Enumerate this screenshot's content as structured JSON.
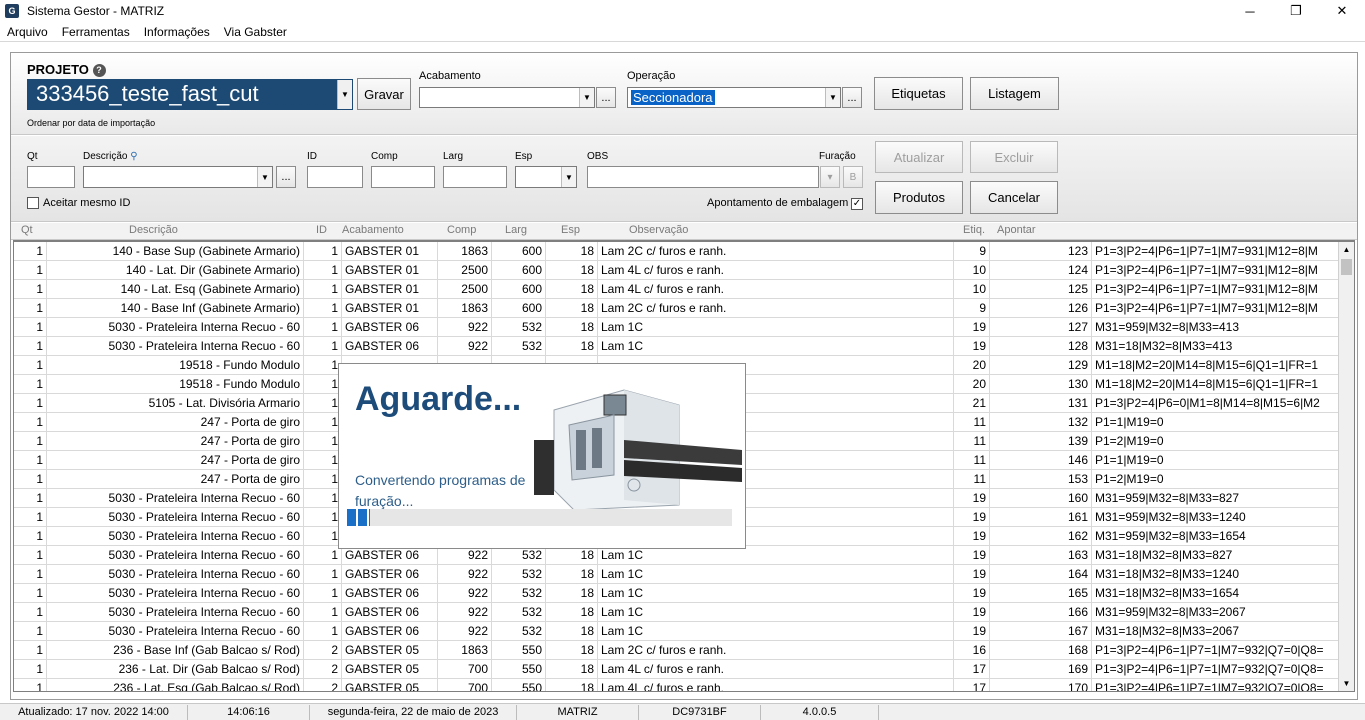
{
  "window": {
    "title": "Sistema Gestor - MATRIZ",
    "app_icon": "G"
  },
  "window_controls": {
    "minimize": "─",
    "maximize": "❐",
    "close": "✕"
  },
  "menu": [
    "Arquivo",
    "Ferramentas",
    "Informações",
    "Via Gabster"
  ],
  "project": {
    "label": "PROJETO",
    "value": "333456_teste_fast_cut",
    "sort_hint": "Ordenar por data de importação",
    "save_label": "Gravar"
  },
  "acabamento": {
    "label": "Acabamento",
    "value": "",
    "more": "..."
  },
  "operacao": {
    "label": "Operação",
    "value": "Seccionadora",
    "more": "..."
  },
  "top_buttons": {
    "etiquetas": "Etiquetas",
    "listagem": "Listagem"
  },
  "form": {
    "qt": "Qt",
    "descricao": "Descrição",
    "id": "ID",
    "comp": "Comp",
    "larg": "Larg",
    "esp": "Esp",
    "obs": "OBS",
    "furacao": "Furação",
    "more": "...",
    "aceitar_mesmo_id": "Aceitar mesmo ID",
    "apontamento": "Apontamento de embalagem",
    "apontamento_checked": "✓"
  },
  "action_buttons": {
    "atualizar": "Atualizar",
    "excluir": "Excluir",
    "produtos": "Produtos",
    "cancelar": "Cancelar"
  },
  "columns": [
    "Qt",
    "Descrição",
    "ID",
    "Acabamento",
    "Comp",
    "Larg",
    "Esp",
    "Observação",
    "Etiq.",
    "Apontar"
  ],
  "rows": [
    {
      "qt": "1",
      "desc": "140 - Base Sup (Gabinete Armario)",
      "id": "1",
      "acab": "GABSTER 01",
      "comp": "1863",
      "larg": "600",
      "esp": "18",
      "obs": "Lam 2C c/ furos e ranh.",
      "etiq": "9",
      "n": "123",
      "prog": "P1=3|P2=4|P6=1|P7=1|M7=931|M12=8|M"
    },
    {
      "qt": "1",
      "desc": "140 - Lat. Dir (Gabinete Armario)",
      "id": "1",
      "acab": "GABSTER 01",
      "comp": "2500",
      "larg": "600",
      "esp": "18",
      "obs": "Lam 4L c/ furos e ranh.",
      "etiq": "10",
      "n": "124",
      "prog": "P1=3|P2=4|P6=1|P7=1|M7=931|M12=8|M"
    },
    {
      "qt": "1",
      "desc": "140 - Lat. Esq (Gabinete Armario)",
      "id": "1",
      "acab": "GABSTER 01",
      "comp": "2500",
      "larg": "600",
      "esp": "18",
      "obs": "Lam 4L c/ furos e ranh.",
      "etiq": "10",
      "n": "125",
      "prog": "P1=3|P2=4|P6=1|P7=1|M7=931|M12=8|M"
    },
    {
      "qt": "1",
      "desc": "140 - Base Inf (Gabinete Armario)",
      "id": "1",
      "acab": "GABSTER 01",
      "comp": "1863",
      "larg": "600",
      "esp": "18",
      "obs": "Lam 2C c/ furos e ranh.",
      "etiq": "9",
      "n": "126",
      "prog": "P1=3|P2=4|P6=1|P7=1|M7=931|M12=8|M"
    },
    {
      "qt": "1",
      "desc": "5030 - Prateleira Interna Recuo - 60",
      "id": "1",
      "acab": "GABSTER 06",
      "comp": "922",
      "larg": "532",
      "esp": "18",
      "obs": "Lam 1C",
      "etiq": "19",
      "n": "127",
      "prog": "M31=959|M32=8|M33=413"
    },
    {
      "qt": "1",
      "desc": "5030 - Prateleira Interna Recuo - 60",
      "id": "1",
      "acab": "GABSTER 06",
      "comp": "922",
      "larg": "532",
      "esp": "18",
      "obs": "Lam 1C",
      "etiq": "19",
      "n": "128",
      "prog": "M31=18|M32=8|M33=413"
    },
    {
      "qt": "1",
      "desc": "19518 - Fundo Modulo",
      "id": "1",
      "acab": "",
      "comp": "",
      "larg": "",
      "esp": "",
      "obs": "",
      "etiq": "20",
      "n": "129",
      "prog": " M1=18|M2=20|M14=8|M15=6|Q1=1|FR=1"
    },
    {
      "qt": "1",
      "desc": "19518 - Fundo Modulo",
      "id": "1",
      "acab": "",
      "comp": "",
      "larg": "",
      "esp": "",
      "obs": "",
      "etiq": "20",
      "n": "130",
      "prog": " M1=18|M2=20|M14=8|M15=6|Q1=1|FR=1"
    },
    {
      "qt": "1",
      "desc": "5105 - Lat. Divisória Armario",
      "id": "1",
      "acab": "",
      "comp": "",
      "larg": "",
      "esp": "",
      "obs": "",
      "etiq": "21",
      "n": "131",
      "prog": "P1=3|P2=4|P6=0|M1=8|M14=8|M15=6|M2"
    },
    {
      "qt": "1",
      "desc": "247 - Porta de giro",
      "id": "1",
      "acab": "",
      "comp": "",
      "larg": "",
      "esp": "",
      "obs": "",
      "etiq": "11",
      "n": "132",
      "prog": "P1=1|M19=0"
    },
    {
      "qt": "1",
      "desc": "247 - Porta de giro",
      "id": "1",
      "acab": "",
      "comp": "",
      "larg": "",
      "esp": "",
      "obs": "",
      "etiq": "11",
      "n": "139",
      "prog": "P1=2|M19=0"
    },
    {
      "qt": "1",
      "desc": "247 - Porta de giro",
      "id": "1",
      "acab": "",
      "comp": "",
      "larg": "",
      "esp": "",
      "obs": "",
      "etiq": "11",
      "n": "146",
      "prog": "P1=1|M19=0"
    },
    {
      "qt": "1",
      "desc": "247 - Porta de giro",
      "id": "1",
      "acab": "",
      "comp": "",
      "larg": "",
      "esp": "",
      "obs": "",
      "etiq": "11",
      "n": "153",
      "prog": "P1=2|M19=0"
    },
    {
      "qt": "1",
      "desc": "5030 - Prateleira Interna Recuo - 60",
      "id": "1",
      "acab": "",
      "comp": "",
      "larg": "",
      "esp": "",
      "obs": "",
      "etiq": "19",
      "n": "160",
      "prog": "M31=959|M32=8|M33=827"
    },
    {
      "qt": "1",
      "desc": "5030 - Prateleira Interna Recuo - 60",
      "id": "1",
      "acab": "",
      "comp": "",
      "larg": "",
      "esp": "",
      "obs": "",
      "etiq": "19",
      "n": "161",
      "prog": "M31=959|M32=8|M33=1240"
    },
    {
      "qt": "1",
      "desc": "5030 - Prateleira Interna Recuo - 60",
      "id": "1",
      "acab": "",
      "comp": "",
      "larg": "",
      "esp": "",
      "obs": "",
      "etiq": "19",
      "n": "162",
      "prog": "M31=959|M32=8|M33=1654"
    },
    {
      "qt": "1",
      "desc": "5030 - Prateleira Interna Recuo - 60",
      "id": "1",
      "acab": "GABSTER 06",
      "comp": "922",
      "larg": "532",
      "esp": "18",
      "obs": "Lam 1C",
      "etiq": "19",
      "n": "163",
      "prog": "M31=18|M32=8|M33=827"
    },
    {
      "qt": "1",
      "desc": "5030 - Prateleira Interna Recuo - 60",
      "id": "1",
      "acab": "GABSTER 06",
      "comp": "922",
      "larg": "532",
      "esp": "18",
      "obs": "Lam 1C",
      "etiq": "19",
      "n": "164",
      "prog": "M31=18|M32=8|M33=1240"
    },
    {
      "qt": "1",
      "desc": "5030 - Prateleira Interna Recuo - 60",
      "id": "1",
      "acab": "GABSTER 06",
      "comp": "922",
      "larg": "532",
      "esp": "18",
      "obs": "Lam 1C",
      "etiq": "19",
      "n": "165",
      "prog": "M31=18|M32=8|M33=1654"
    },
    {
      "qt": "1",
      "desc": "5030 - Prateleira Interna Recuo - 60",
      "id": "1",
      "acab": "GABSTER 06",
      "comp": "922",
      "larg": "532",
      "esp": "18",
      "obs": "Lam 1C",
      "etiq": "19",
      "n": "166",
      "prog": "M31=959|M32=8|M33=2067"
    },
    {
      "qt": "1",
      "desc": "5030 - Prateleira Interna Recuo - 60",
      "id": "1",
      "acab": "GABSTER 06",
      "comp": "922",
      "larg": "532",
      "esp": "18",
      "obs": "Lam 1C",
      "etiq": "19",
      "n": "167",
      "prog": "M31=18|M32=8|M33=2067"
    },
    {
      "qt": "1",
      "desc": "236 - Base Inf (Gab Balcao s/ Rod)",
      "id": "2",
      "acab": "GABSTER 05",
      "comp": "1863",
      "larg": "550",
      "esp": "18",
      "obs": "Lam 2C c/ furos e ranh.",
      "etiq": "16",
      "n": "168",
      "prog": "P1=3|P2=4|P6=1|P7=1|M7=932|Q7=0|Q8="
    },
    {
      "qt": "1",
      "desc": "236 - Lat. Dir (Gab Balcao s/ Rod)",
      "id": "2",
      "acab": "GABSTER 05",
      "comp": "700",
      "larg": "550",
      "esp": "18",
      "obs": "Lam 4L c/ furos e ranh.",
      "etiq": "17",
      "n": "169",
      "prog": "P1=3|P2=4|P6=1|P7=1|M7=932|Q7=0|Q8="
    },
    {
      "qt": "1",
      "desc": "236 - Lat. Esq (Gab Balcao s/ Rod)",
      "id": "2",
      "acab": "GABSTER 05",
      "comp": "700",
      "larg": "550",
      "esp": "18",
      "obs": "Lam 4L c/ furos e ranh.",
      "etiq": "17",
      "n": "170",
      "prog": "P1=3|P2=4|P6=1|P7=1|M7=932|Q7=0|Q8="
    }
  ],
  "modal": {
    "title": "Aguarde...",
    "message": "Convertendo programas de furação...",
    "progress": 0.06
  },
  "status": [
    "Atualizado: 17 nov. 2022 14:00",
    "14:06:16",
    "segunda-feira, 22 de maio de 2023",
    "MATRIZ",
    "DC9731BF",
    "4.0.0.5"
  ],
  "colors": {
    "accent": "#1d4c7a",
    "selection": "#0a64c8",
    "progress": "#1a6fc7"
  }
}
